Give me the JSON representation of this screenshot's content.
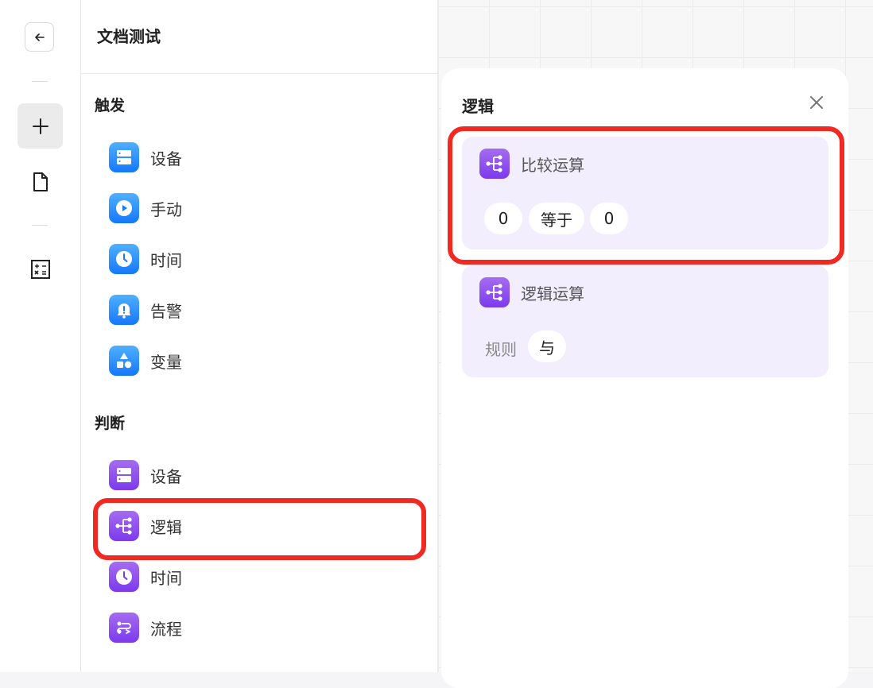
{
  "sidebar": {
    "back_icon": "arrow-left-icon",
    "add_icon": "plus-icon",
    "doc_icon": "document-icon",
    "calc_icon": "calculator-icon"
  },
  "panel": {
    "title": "文档测试",
    "trigger": {
      "title": "触发",
      "items": [
        {
          "label": "设备",
          "icon": "device-icon"
        },
        {
          "label": "手动",
          "icon": "play-icon"
        },
        {
          "label": "时间",
          "icon": "clock-icon"
        },
        {
          "label": "告警",
          "icon": "bell-alert-icon"
        },
        {
          "label": "变量",
          "icon": "shapes-icon"
        }
      ]
    },
    "judge": {
      "title": "判断",
      "items": [
        {
          "label": "设备",
          "icon": "device-icon"
        },
        {
          "label": "逻辑",
          "icon": "logic-branch-icon"
        },
        {
          "label": "时间",
          "icon": "clock-icon"
        },
        {
          "label": "流程",
          "icon": "flow-icon"
        }
      ]
    }
  },
  "detail": {
    "title": "逻辑",
    "close_icon": "close-icon",
    "compare": {
      "title": "比较运算",
      "left_value": "0",
      "operator": "等于",
      "right_value": "0"
    },
    "logic": {
      "title": "逻辑运算",
      "rule_label": "规则",
      "rule_value": "与"
    }
  },
  "colors": {
    "trigger_icon": "#1677ff",
    "judge_icon": "#7c3aed",
    "highlight": "#f02a23",
    "card_bg": "#f3eefd"
  }
}
